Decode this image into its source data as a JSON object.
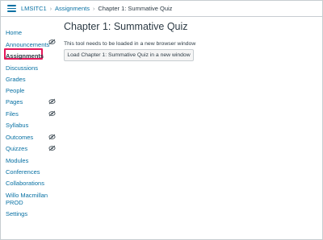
{
  "breadcrumb": {
    "course": "LMSITC1",
    "section": "Assignments",
    "current": "Chapter 1: Summative Quiz",
    "separator": "›"
  },
  "sidebar": {
    "items": [
      {
        "label": "Home",
        "hidden": false,
        "active": false
      },
      {
        "label": "Announcements",
        "hidden": true,
        "active": false
      },
      {
        "label": "Assignments",
        "hidden": false,
        "active": true
      },
      {
        "label": "Discussions",
        "hidden": false,
        "active": false
      },
      {
        "label": "Grades",
        "hidden": false,
        "active": false
      },
      {
        "label": "People",
        "hidden": false,
        "active": false
      },
      {
        "label": "Pages",
        "hidden": true,
        "active": false
      },
      {
        "label": "Files",
        "hidden": true,
        "active": false
      },
      {
        "label": "Syllabus",
        "hidden": false,
        "active": false
      },
      {
        "label": "Outcomes",
        "hidden": true,
        "active": false
      },
      {
        "label": "Quizzes",
        "hidden": true,
        "active": false
      },
      {
        "label": "Modules",
        "hidden": false,
        "active": false
      },
      {
        "label": "Conferences",
        "hidden": false,
        "active": false
      },
      {
        "label": "Collaborations",
        "hidden": false,
        "active": false
      },
      {
        "label": "Willo Macmillan PROD",
        "hidden": false,
        "active": false
      },
      {
        "label": "Settings",
        "hidden": false,
        "active": false
      }
    ]
  },
  "main": {
    "title": "Chapter 1: Summative Quiz",
    "notice": "This tool needs to be loaded in a new browser window",
    "load_button": "Load Chapter 1: Summative Quiz in a new window"
  },
  "icons": {
    "menu": "hamburger-menu-icon",
    "hidden": "eye-slash-icon"
  },
  "colors": {
    "link": "#0770a3",
    "text": "#2d3b45",
    "highlight": "#e5175a",
    "border": "#c7cdd1",
    "button_bg": "#f5f5f5"
  }
}
